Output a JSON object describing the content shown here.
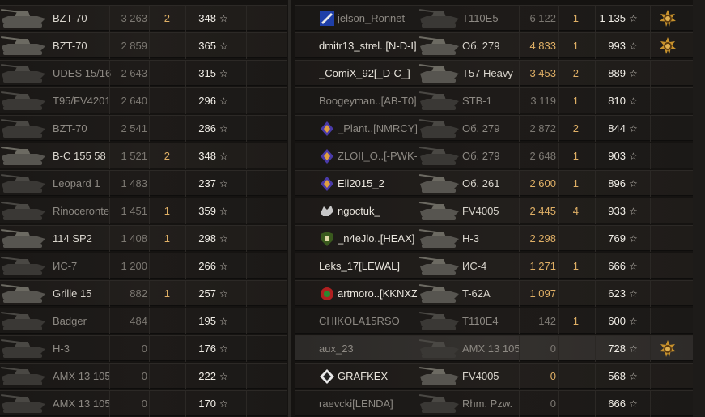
{
  "left_team": [
    {
      "tank": "BZT-70",
      "damage": "3 263",
      "kills": "2",
      "xp": "348",
      "dead": false
    },
    {
      "tank": "BZT-70",
      "damage": "2 859",
      "kills": "",
      "xp": "365",
      "dead": false
    },
    {
      "tank": "UDES 15/16",
      "damage": "2 643",
      "kills": "",
      "xp": "315",
      "dead": true
    },
    {
      "tank": "T95/FV4201",
      "damage": "2 640",
      "kills": "",
      "xp": "296",
      "dead": true
    },
    {
      "tank": "BZT-70",
      "damage": "2 541",
      "kills": "",
      "xp": "286",
      "dead": true
    },
    {
      "tank": "B-C 155 58",
      "damage": "1 521",
      "kills": "2",
      "xp": "348",
      "dead": false
    },
    {
      "tank": "Leopard 1",
      "damage": "1 483",
      "kills": "",
      "xp": "237",
      "dead": true
    },
    {
      "tank": "Rinoceronte",
      "damage": "1 451",
      "kills": "1",
      "xp": "359",
      "dead": true
    },
    {
      "tank": "114 SP2",
      "damage": "1 408",
      "kills": "1",
      "xp": "298",
      "dead": false
    },
    {
      "tank": "ИС-7",
      "damage": "1 200",
      "kills": "",
      "xp": "266",
      "dead": true
    },
    {
      "tank": "Grille 15",
      "damage": "882",
      "kills": "1",
      "xp": "257",
      "dead": false
    },
    {
      "tank": "Badger",
      "damage": "484",
      "kills": "",
      "xp": "195",
      "dead": true
    },
    {
      "tank": "H-3",
      "damage": "0",
      "kills": "",
      "xp": "176",
      "dead": true
    },
    {
      "tank": "AMX 13 105",
      "damage": "0",
      "kills": "",
      "xp": "222",
      "dead": true
    },
    {
      "tank": "AMX 13 105",
      "damage": "0",
      "kills": "",
      "xp": "170",
      "dead": true
    }
  ],
  "right_team": [
    {
      "player": "jelson_Ronnet",
      "tank": "T110E5",
      "damage": "6 122",
      "kills": "1",
      "xp": "1 135",
      "dead": true,
      "clan_icon": "blue-emblem-icon",
      "medal": true
    },
    {
      "player": "dmitr13_strel..[N-D-I]",
      "tank": "Об. 279",
      "damage": "4 833",
      "kills": "1",
      "xp": "993",
      "dead": false,
      "clan_icon": "",
      "medal": true
    },
    {
      "player": "_ComiX_92[_D-C_]",
      "tank": "T57 Heavy",
      "damage": "3 453",
      "kills": "2",
      "xp": "889",
      "dead": false,
      "clan_icon": "",
      "medal": false
    },
    {
      "player": "Boogeyman..[AB-T0]",
      "tank": "STB-1",
      "damage": "3 119",
      "kills": "1",
      "xp": "810",
      "dead": true,
      "clan_icon": "",
      "medal": false
    },
    {
      "player": "_Plant..[NMRCY]",
      "tank": "Об. 279",
      "damage": "2 872",
      "kills": "2",
      "xp": "844",
      "dead": true,
      "clan_icon": "purple-emblem-icon",
      "medal": false
    },
    {
      "player": "ZLOII_O..[-PWK-]",
      "tank": "Об. 279",
      "damage": "2 648",
      "kills": "1",
      "xp": "903",
      "dead": true,
      "clan_icon": "purple-emblem-icon",
      "medal": false
    },
    {
      "player": "Ell2015_2",
      "tank": "Об. 261",
      "damage": "2 600",
      "kills": "1",
      "xp": "896",
      "dead": false,
      "clan_icon": "purple-emblem-icon",
      "medal": false
    },
    {
      "player": "ngoctuk_",
      "tank": "FV4005",
      "damage": "2 445",
      "kills": "4",
      "xp": "933",
      "dead": false,
      "clan_icon": "wolf-emblem-icon",
      "medal": false
    },
    {
      "player": "_n4eJlo..[HEAX]",
      "tank": "H-3",
      "damage": "2 298",
      "kills": "",
      "xp": "769",
      "dead": false,
      "clan_icon": "shield-emblem-icon",
      "medal": false
    },
    {
      "player": "Leks_17[LEWAL]",
      "tank": "ИС-4",
      "damage": "1 271",
      "kills": "1",
      "xp": "666",
      "dead": false,
      "clan_icon": "",
      "medal": false
    },
    {
      "player": "artmoro..[KKNXZ]",
      "tank": "T-62A",
      "damage": "1 097",
      "kills": "",
      "xp": "623",
      "dead": false,
      "clan_icon": "red-emblem-icon",
      "medal": false
    },
    {
      "player": "CHIKOLA15RSO",
      "tank": "T110E4",
      "damage": "142",
      "kills": "1",
      "xp": "600",
      "dead": true,
      "clan_icon": "",
      "medal": false
    },
    {
      "player": "aux_23",
      "tank": "AMX 13 105",
      "damage": "0",
      "kills": "",
      "xp": "728",
      "dead": true,
      "clan_icon": "",
      "medal": true,
      "highlight": true
    },
    {
      "player": "GRAFKEX",
      "tank": "FV4005",
      "damage": "0",
      "kills": "",
      "xp": "568",
      "dead": false,
      "clan_icon": "diamond-emblem-icon",
      "medal": false
    },
    {
      "player": "raevcki[LENDA]",
      "tank": "Rhm. Pzw.",
      "damage": "0",
      "kills": "",
      "xp": "666",
      "dead": true,
      "clan_icon": "",
      "medal": false
    }
  ],
  "xp_star_glyph": "☆",
  "colors": {
    "damage_alive": "#e0b066",
    "text_dead": "#8d8983",
    "text_alive": "#e8e4dc",
    "medal_gold": "#d8a640"
  }
}
